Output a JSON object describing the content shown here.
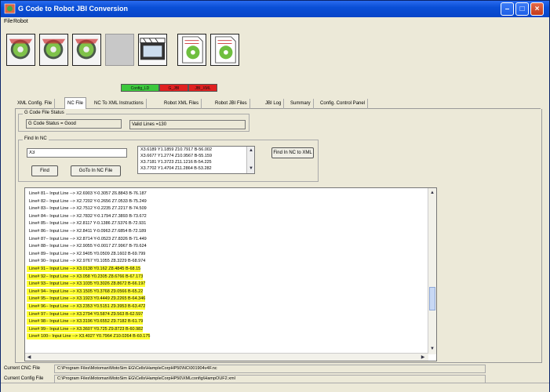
{
  "window": {
    "title": "G Code to Robot JBI Conversion"
  },
  "menu": {
    "items": [
      "File",
      "Robot"
    ]
  },
  "toolbar": {
    "buttons": [
      {
        "icon": "gear-icon"
      },
      {
        "icon": "gear-icon"
      },
      {
        "icon": "gear-icon"
      },
      {
        "icon": "blank-icon"
      },
      {
        "icon": "clapperboard-icon"
      },
      {
        "icon": "document-gear-icon"
      },
      {
        "icon": "document-gear-icon"
      }
    ]
  },
  "status_flags": [
    {
      "label": "Config_LD",
      "color": "#3cc83c"
    },
    {
      "label": "G_JBI",
      "color": "#e02020"
    },
    {
      "label": "JBI_XML",
      "color": "#e02020"
    }
  ],
  "tabs": [
    {
      "label": "XML Config. File",
      "active": false
    },
    {
      "label": "NC File",
      "active": true
    },
    {
      "label": "NC To XML Instructions",
      "active": false
    },
    {
      "label": "Robot XML Files",
      "active": false
    },
    {
      "label": "Robot JBI Files",
      "active": false
    },
    {
      "label": "JBI Log",
      "active": false
    },
    {
      "label": "Summary",
      "active": false
    },
    {
      "label": "Config. Control Panel",
      "active": false
    }
  ],
  "gcode_status": {
    "group_title": "G Code File Status",
    "status_value": "G Code Status = Good",
    "valid_lines": "Valid Lines =130"
  },
  "find": {
    "group_title": "Find In NC",
    "input_value": "X3",
    "results": [
      "X3.6189 Y1.1859 Z10.7917 B-56.002",
      "X3.6677 Y1.2774 Z10.9567 B-55.159",
      "X3.7181 Y1.3723 Z11.1216 B-54.225",
      "X3.7702 Y1.4704 Z11.2864 B-53.282"
    ],
    "find_button": "Find",
    "goto_button": "GoTo In NC File",
    "find_xml_button": "Find In NC to XML"
  },
  "log": {
    "lines": [
      {
        "text": "Line# 81-- Input Line --> X2.6903 Y-0.3057 Z6.8843 B-76.187",
        "highlight": false
      },
      {
        "text": "Line# 82-- Input Line --> X2.7202 Y-0.2656 Z7.0533 B-75.249",
        "highlight": false
      },
      {
        "text": "Line# 83-- Input Line --> X2.7512 Y-0.2235 Z7.2217 B-74.509",
        "highlight": false
      },
      {
        "text": "Line# 84-- Input Line --> X2.7832 Y-0.1794 Z7.3893 B-73.672",
        "highlight": false
      },
      {
        "text": "Line# 85-- Input Line --> X2.8117 Y-0.1386 Z7.5376 B-72.931",
        "highlight": false
      },
      {
        "text": "Line# 86-- Input Line --> X2.8411 Y-0.0963 Z7.6854 B-72.189",
        "highlight": false
      },
      {
        "text": "Line# 87-- Input Line --> X2.8714 Y-0.0523 Z7.8326 B-71.449",
        "highlight": false
      },
      {
        "text": "Line# 88-- Input Line --> X2.9055 Y-0.0017 Z7.9967 B-70.624",
        "highlight": false
      },
      {
        "text": "Line# 89-- Input Line --> X2.9405 Y0.0509 Z8.1602 B-69.799",
        "highlight": false
      },
      {
        "text": "Line# 90-- Input Line --> X2.9767 Y0.1055 Z8.3229 B-68.974",
        "highlight": false
      },
      {
        "text": "Line# 91-- Input Line --> X3.0138 Y0.162 Z8.4845 B-68.15",
        "highlight": true
      },
      {
        "text": "Line# 92-- Input Line --> X3.058 Y0.2305 Z8.6766 B-67.173",
        "highlight": true
      },
      {
        "text": "Line# 93-- Input Line --> X3.1035 Y0.3026 Z8.8672 B-66.197",
        "highlight": true
      },
      {
        "text": "Line# 94-- Input Line --> X3.1505 Y0.3768 Z9.0566 B-65.22",
        "highlight": true
      },
      {
        "text": "Line# 95-- Input Line --> X3.1923 Y0.4449 Z9.2265 B-64.346",
        "highlight": true
      },
      {
        "text": "Line# 96-- Input Line --> X3.2353 Y0.5151 Z9.3953 B-63.472",
        "highlight": true
      },
      {
        "text": "Line# 97-- Input Line --> X3.2794 Y0.5874 Z9.563 B-62.597",
        "highlight": true
      },
      {
        "text": "Line# 98-- Input Line --> X3.3196 Y0.6552 Z9.7182 B-61.79",
        "highlight": true
      },
      {
        "text": "Line# 99-- Input Line --> X3.3607 Y0.725 Z9.8723 B-60.982",
        "highlight": true
      },
      {
        "text": "Line# 100-- Input Line --> X3.4027 Y0.7964 Z10.0264 B-60.175",
        "highlight": true
      }
    ]
  },
  "current_cnc": {
    "label": "Current CNC File",
    "path": "C:\\Program Files\\Motoman\\MotoSim EG\\Cells\\HampleCorpHP50\\NC\\001904v4F.nc"
  },
  "current_config": {
    "label": "Current Config File",
    "path": "C:\\Program Files\\Motoman\\MotoSim EG\\Cells\\HampleCorpHP50\\XMLconfig\\HampOUF2.xml"
  }
}
